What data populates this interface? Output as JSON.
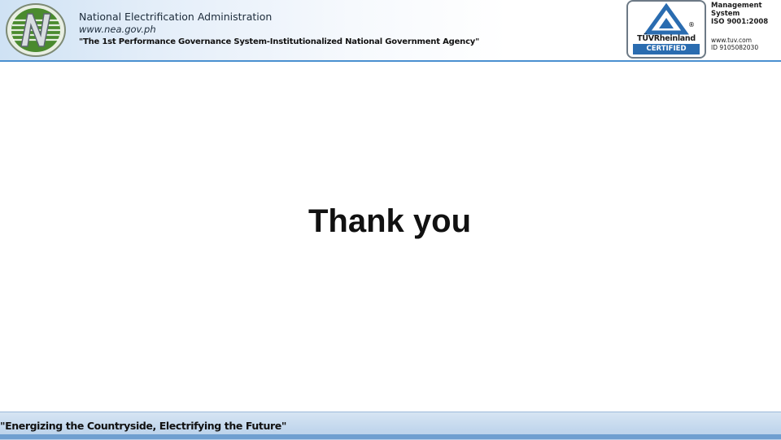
{
  "header": {
    "org_name": "National Electrification Administration",
    "url": "www.nea.gov.ph",
    "tagline": "\"The 1st Performance Governance System-Institutionalized National Government Agency\"",
    "logo_icon": "nea-logo-icon"
  },
  "certification": {
    "brand": "TÜVRheinland",
    "certified_label": "CERTIFIED",
    "line1": "Management",
    "line2": "System",
    "line3": "ISO 9001:2008",
    "line4": "www.tuv.com",
    "line5": "ID 9105082030",
    "registered_mark": "®",
    "badge_icon": "tuv-triangle-icon"
  },
  "slide": {
    "title": "Thank you"
  },
  "footer": {
    "slogan": "\"Energizing the Countryside, Electrifying the Future\""
  },
  "colors": {
    "header_blue": "#1e6fb8",
    "tuv_blue": "#2a6cb0",
    "logo_green": "#4a8a2e"
  }
}
